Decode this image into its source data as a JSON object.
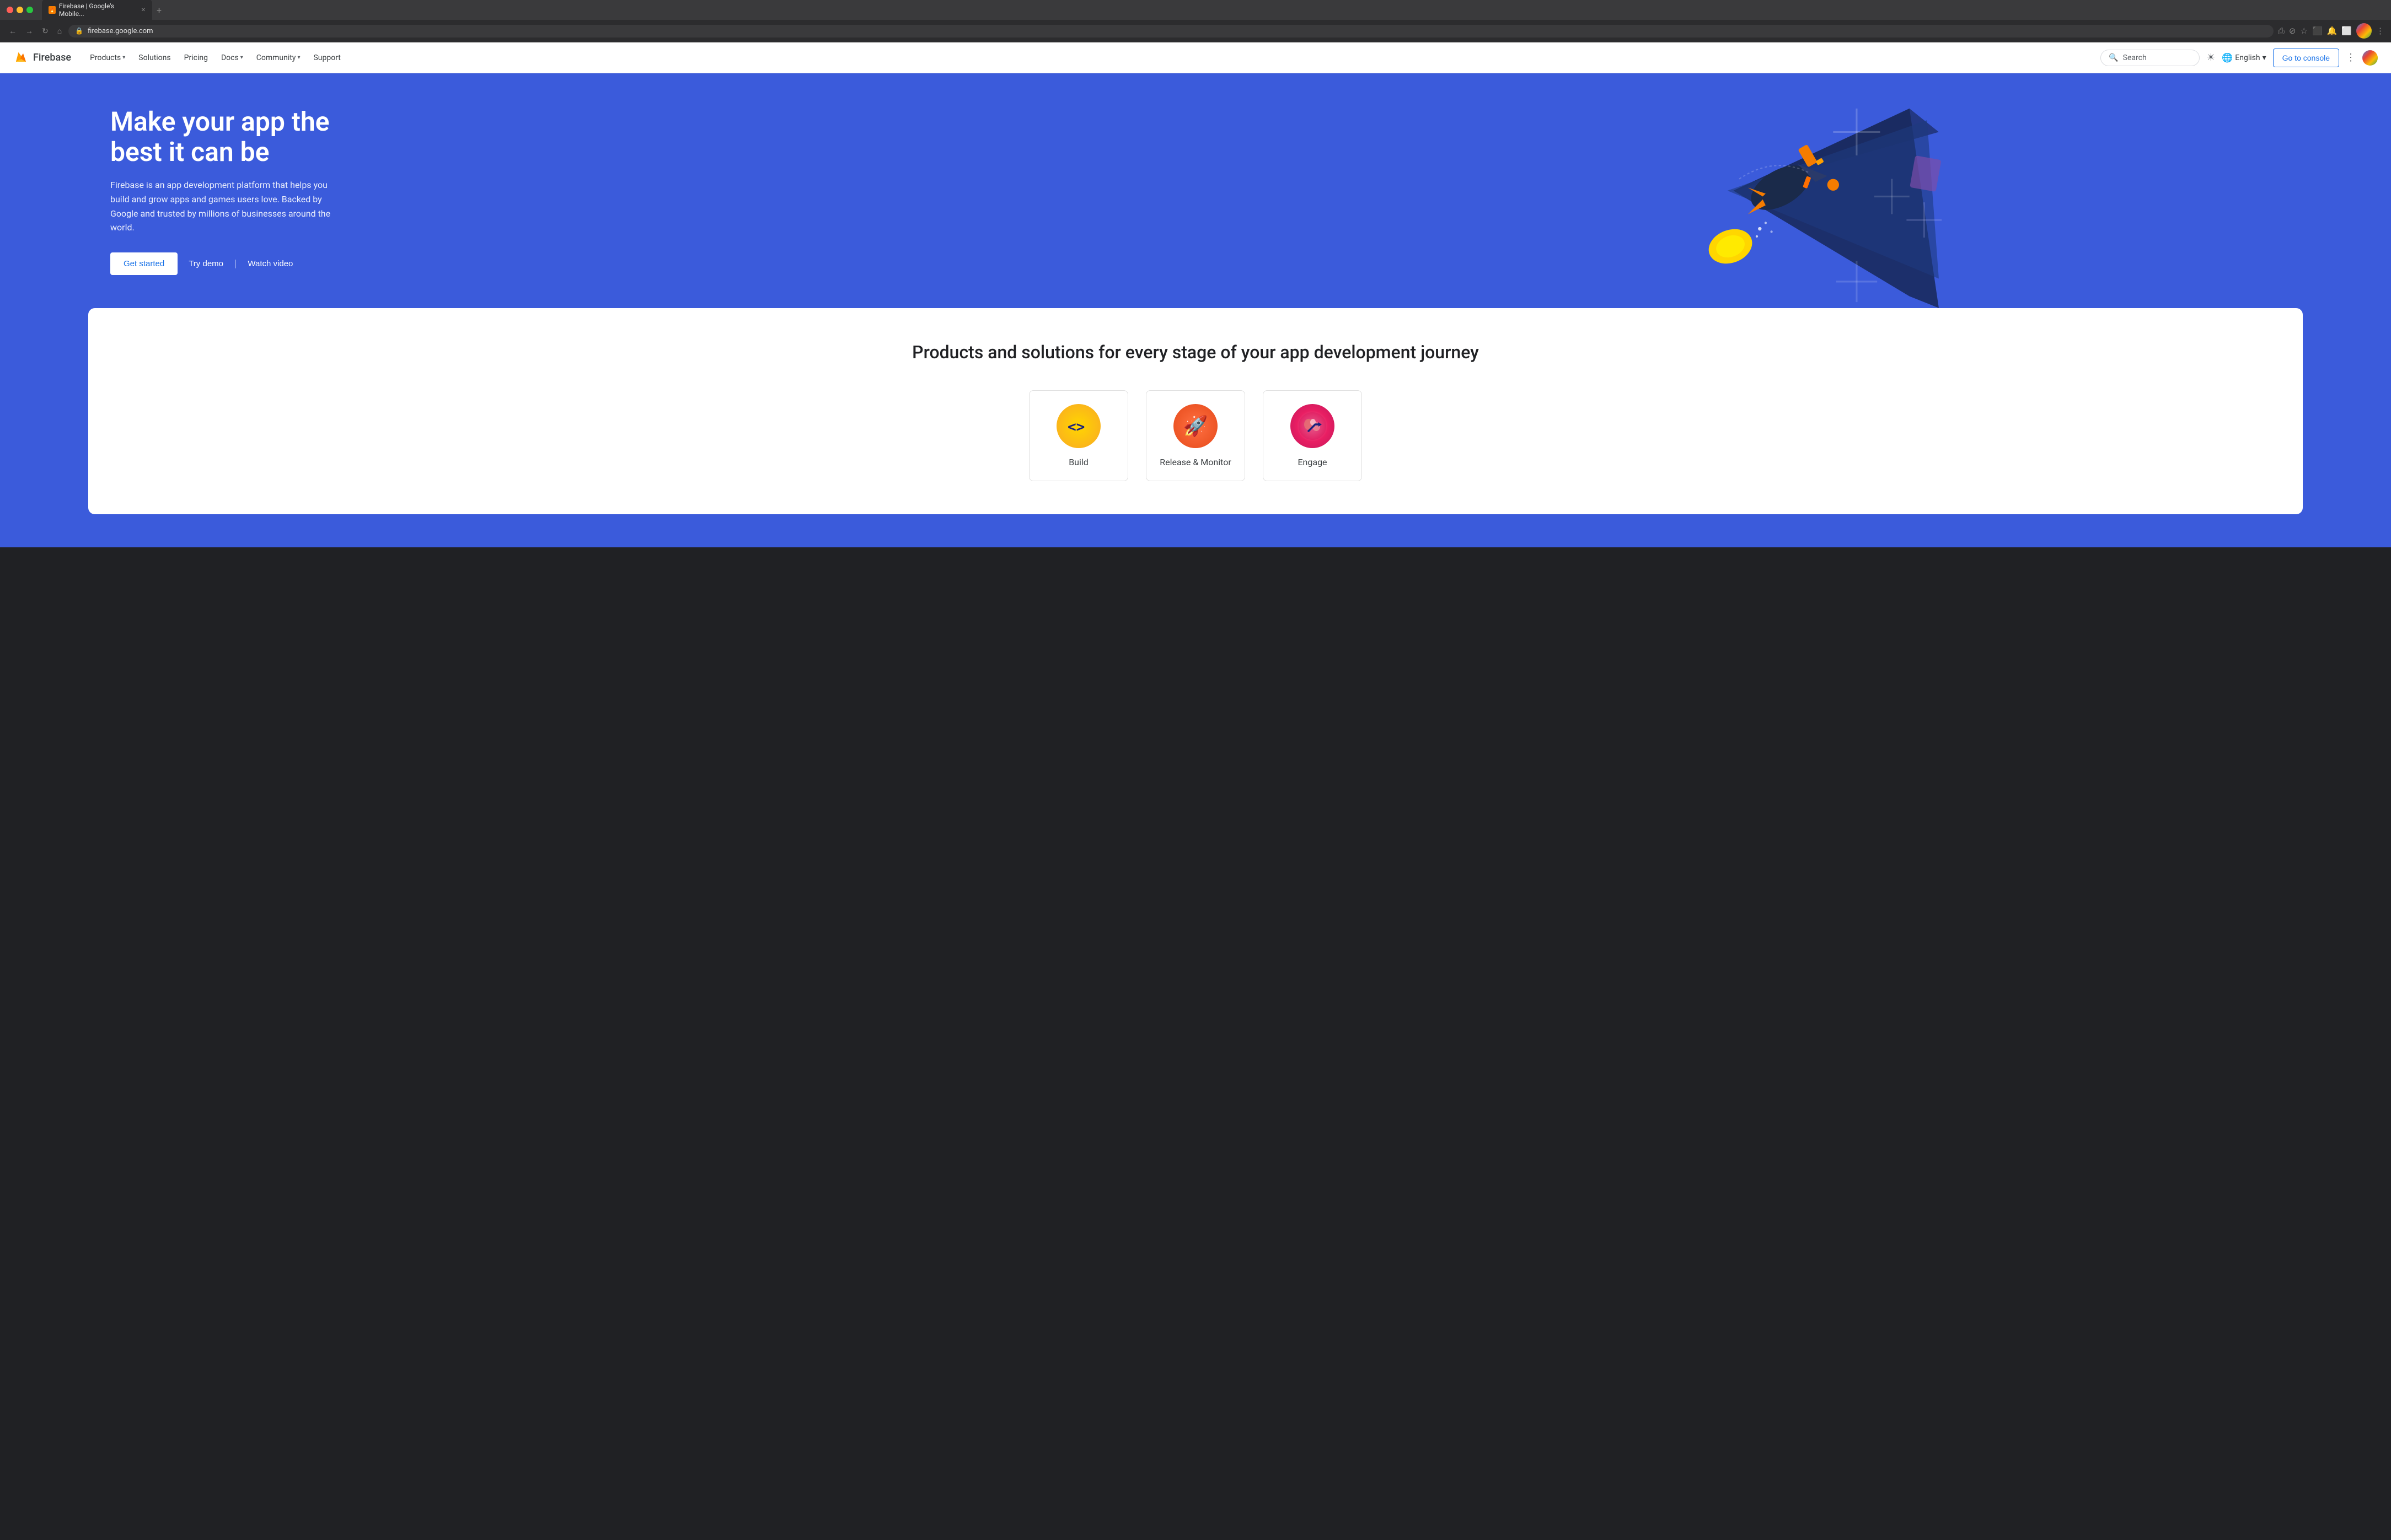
{
  "browser": {
    "tab_title": "Firebase | Google's Mobile...",
    "tab_favicon": "🔥",
    "url": "firebase.google.com",
    "new_tab_label": "+",
    "back_label": "←",
    "forward_label": "→",
    "refresh_label": "↻",
    "home_label": "⌂"
  },
  "nav": {
    "logo_text": "Firebase",
    "links": [
      {
        "label": "Products",
        "has_dropdown": true
      },
      {
        "label": "Solutions",
        "has_dropdown": false
      },
      {
        "label": "Pricing",
        "has_dropdown": false
      },
      {
        "label": "Docs",
        "has_dropdown": true
      },
      {
        "label": "Community",
        "has_dropdown": true
      },
      {
        "label": "Support",
        "has_dropdown": false
      }
    ],
    "search_placeholder": "Search",
    "language_label": "English",
    "go_to_console_label": "Go to console"
  },
  "hero": {
    "title": "Make your app the best it can be",
    "subtitle": "Firebase is an app development platform that helps you build and grow apps and games users love. Backed by Google and trusted by millions of businesses around the world.",
    "get_started_label": "Get started",
    "try_demo_label": "Try demo",
    "watch_video_label": "Watch video",
    "bg_color": "#3b5bdb"
  },
  "products": {
    "title": "Products and solutions for every stage of your app development journey",
    "items": [
      {
        "name": "Build",
        "icon_type": "build"
      },
      {
        "name": "Release & Monitor",
        "icon_type": "release"
      },
      {
        "name": "Engage",
        "icon_type": "engage"
      }
    ]
  }
}
